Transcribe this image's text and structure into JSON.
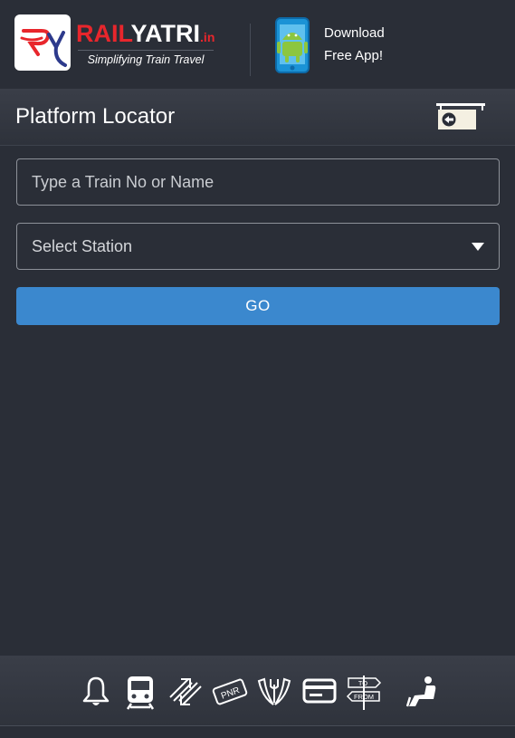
{
  "header": {
    "brand_rail": "RAIL",
    "brand_yatri": "YATRI",
    "brand_tld": ".in",
    "tagline": "Simplifying Train Travel",
    "download_line1": "Download",
    "download_line2": "Free App!"
  },
  "page": {
    "title": "Platform Locator"
  },
  "form": {
    "train_placeholder": "Type a Train No or Name",
    "station_selected": "Select Station",
    "go_label": "GO"
  },
  "icons": {
    "logo": "railyatri-logo-icon",
    "app": "android-phone-icon",
    "back": "back-signboard-icon",
    "nav": [
      "bell-icon",
      "train-icon",
      "swap-arrows-icon",
      "pnr-ticket-icon",
      "food-icon",
      "card-icon",
      "to-from-signpost-icon",
      "seat-icon"
    ]
  },
  "nav_labels": {
    "pnr": "PNR",
    "to": "TO",
    "from": "FROM"
  },
  "colors": {
    "background": "#2a2e37",
    "accent_blue": "#3b88ce",
    "brand_red": "#e8262c"
  }
}
